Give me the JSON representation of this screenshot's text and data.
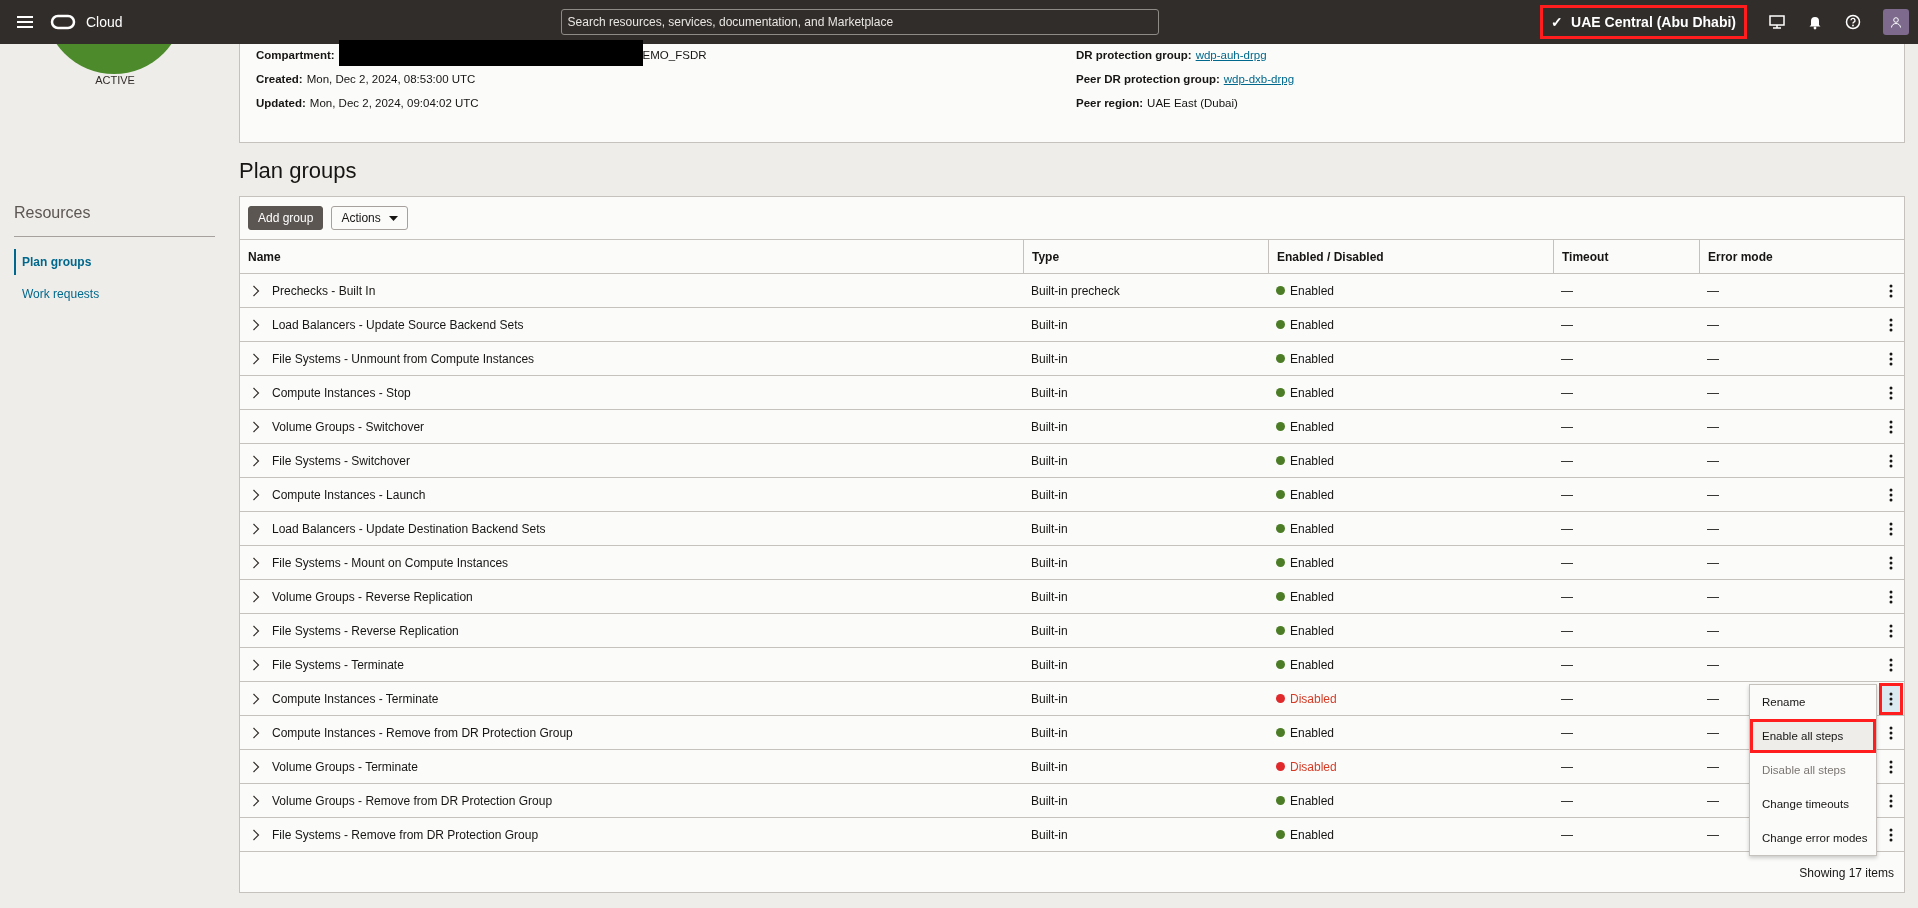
{
  "top_bar": {
    "brand": "Cloud",
    "search": {
      "placeholder": "Search resources, services, documentation, and Marketplace"
    },
    "region": {
      "check": "✓",
      "label": "UAE Central (Abu Dhabi)",
      "annotated": true
    }
  },
  "status": {
    "label": "ACTIVE"
  },
  "details": {
    "left": [
      {
        "label": "Compartment:",
        "value": "EMO_FSDR",
        "redacted": true
      },
      {
        "label": "Created:",
        "value": "Mon, Dec 2, 2024, 08:53:00 UTC",
        "redacted": false
      },
      {
        "label": "Updated:",
        "value": "Mon, Dec 2, 2024, 09:04:02 UTC",
        "redacted": false
      }
    ],
    "right": [
      {
        "label": "DR protection group:",
        "value": "wdp-auh-drpg",
        "kind": "link"
      },
      {
        "label": "Peer DR protection group:",
        "value": "wdp-dxb-drpg",
        "kind": "link"
      },
      {
        "label": "Peer region:",
        "value": "UAE East (Dubai)",
        "kind": "text"
      }
    ]
  },
  "sidebar": {
    "title": "Resources",
    "items": [
      {
        "label": "Plan groups",
        "selected": true
      },
      {
        "label": "Work requests",
        "selected": false
      }
    ]
  },
  "page_title": "Plan groups",
  "toolbar": {
    "add_button": "Add group",
    "actions_button": "Actions"
  },
  "table": {
    "columns": [
      "Name",
      "Type",
      "Enabled / Disabled",
      "Timeout",
      "Error mode"
    ],
    "rows": [
      {
        "name": "Prechecks - Built In",
        "type": "Built-in precheck",
        "enabled": true,
        "status": "Enabled",
        "timeout": "—",
        "error_mode": "—",
        "menu_open": false
      },
      {
        "name": "Load Balancers - Update Source Backend Sets",
        "type": "Built-in",
        "enabled": true,
        "status": "Enabled",
        "timeout": "—",
        "error_mode": "—",
        "menu_open": false
      },
      {
        "name": "File Systems - Unmount from Compute Instances",
        "type": "Built-in",
        "enabled": true,
        "status": "Enabled",
        "timeout": "—",
        "error_mode": "—",
        "menu_open": false
      },
      {
        "name": "Compute Instances - Stop",
        "type": "Built-in",
        "enabled": true,
        "status": "Enabled",
        "timeout": "—",
        "error_mode": "—",
        "menu_open": false
      },
      {
        "name": "Volume Groups - Switchover",
        "type": "Built-in",
        "enabled": true,
        "status": "Enabled",
        "timeout": "—",
        "error_mode": "—",
        "menu_open": false
      },
      {
        "name": "File Systems - Switchover",
        "type": "Built-in",
        "enabled": true,
        "status": "Enabled",
        "timeout": "—",
        "error_mode": "—",
        "menu_open": false
      },
      {
        "name": "Compute Instances - Launch",
        "type": "Built-in",
        "enabled": true,
        "status": "Enabled",
        "timeout": "—",
        "error_mode": "—",
        "menu_open": false
      },
      {
        "name": "Load Balancers - Update Destination Backend Sets",
        "type": "Built-in",
        "enabled": true,
        "status": "Enabled",
        "timeout": "—",
        "error_mode": "—",
        "menu_open": false
      },
      {
        "name": "File Systems - Mount on Compute Instances",
        "type": "Built-in",
        "enabled": true,
        "status": "Enabled",
        "timeout": "—",
        "error_mode": "—",
        "menu_open": false
      },
      {
        "name": "Volume Groups - Reverse Replication",
        "type": "Built-in",
        "enabled": true,
        "status": "Enabled",
        "timeout": "—",
        "error_mode": "—",
        "menu_open": false
      },
      {
        "name": "File Systems - Reverse Replication",
        "type": "Built-in",
        "enabled": true,
        "status": "Enabled",
        "timeout": "—",
        "error_mode": "—",
        "menu_open": false
      },
      {
        "name": "File Systems - Terminate",
        "type": "Built-in",
        "enabled": true,
        "status": "Enabled",
        "timeout": "—",
        "error_mode": "—",
        "menu_open": false
      },
      {
        "name": "Compute Instances - Terminate",
        "type": "Built-in",
        "enabled": false,
        "status": "Disabled",
        "timeout": "—",
        "error_mode": "—",
        "menu_open": true
      },
      {
        "name": "Compute Instances - Remove from DR Protection Group",
        "type": "Built-in",
        "enabled": true,
        "status": "Enabled",
        "timeout": "—",
        "error_mode": "—",
        "menu_open": false
      },
      {
        "name": "Volume Groups - Terminate",
        "type": "Built-in",
        "enabled": false,
        "status": "Disabled",
        "timeout": "—",
        "error_mode": "—",
        "menu_open": false
      },
      {
        "name": "Volume Groups - Remove from DR Protection Group",
        "type": "Built-in",
        "enabled": true,
        "status": "Enabled",
        "timeout": "—",
        "error_mode": "—",
        "menu_open": false
      },
      {
        "name": "File Systems - Remove from DR Protection Group",
        "type": "Built-in",
        "enabled": true,
        "status": "Enabled",
        "timeout": "—",
        "error_mode": "—",
        "menu_open": false
      }
    ],
    "footer": "Showing 17 items"
  },
  "row_menu": {
    "items": [
      {
        "label": "Rename",
        "disabled": false,
        "selected": false,
        "annotated": false
      },
      {
        "label": "Enable all steps",
        "disabled": false,
        "selected": true,
        "annotated": true
      },
      {
        "label": "Disable all steps",
        "disabled": true,
        "selected": false,
        "annotated": false
      },
      {
        "label": "Change timeouts",
        "disabled": false,
        "selected": false,
        "annotated": false
      },
      {
        "label": "Change error modes",
        "disabled": false,
        "selected": false,
        "annotated": false
      }
    ]
  }
}
